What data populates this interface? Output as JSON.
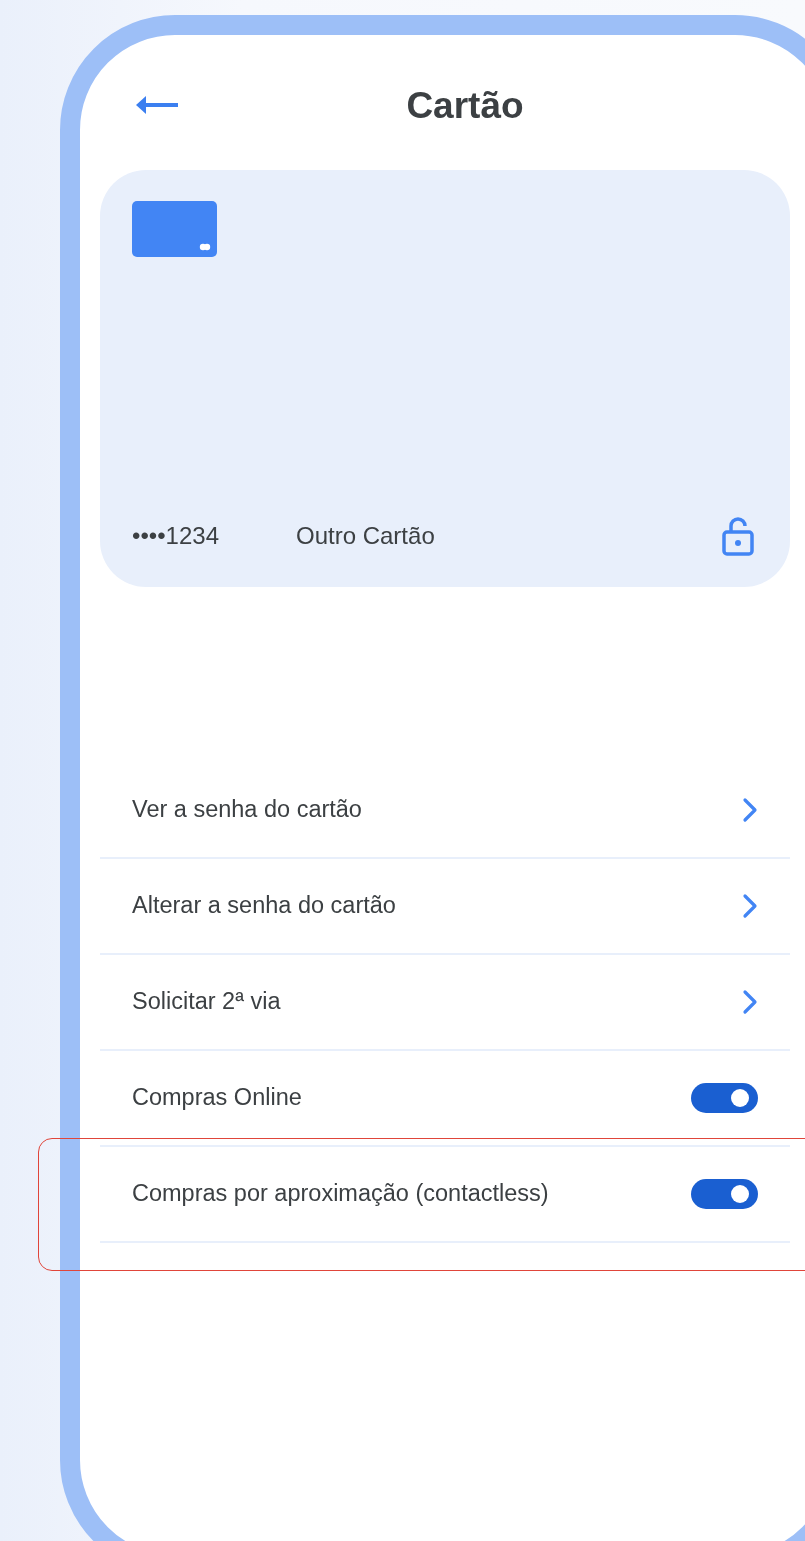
{
  "title": "Cartão",
  "card": {
    "number": "••••1234",
    "name": "Outro Cartão",
    "locked": false
  },
  "options": [
    {
      "kind": "link",
      "label": "Ver a senha do cartão",
      "highlighted": false
    },
    {
      "kind": "link",
      "label": "Alterar a senha do cartão",
      "highlighted": false
    },
    {
      "kind": "link",
      "label": "Solicitar 2ª via",
      "highlighted": false
    },
    {
      "kind": "toggle",
      "label": "Compras Online",
      "on": true,
      "highlighted": false
    },
    {
      "kind": "toggle",
      "label": "Compras por aproximação (contactless)",
      "on": true,
      "highlighted": true
    }
  ]
}
